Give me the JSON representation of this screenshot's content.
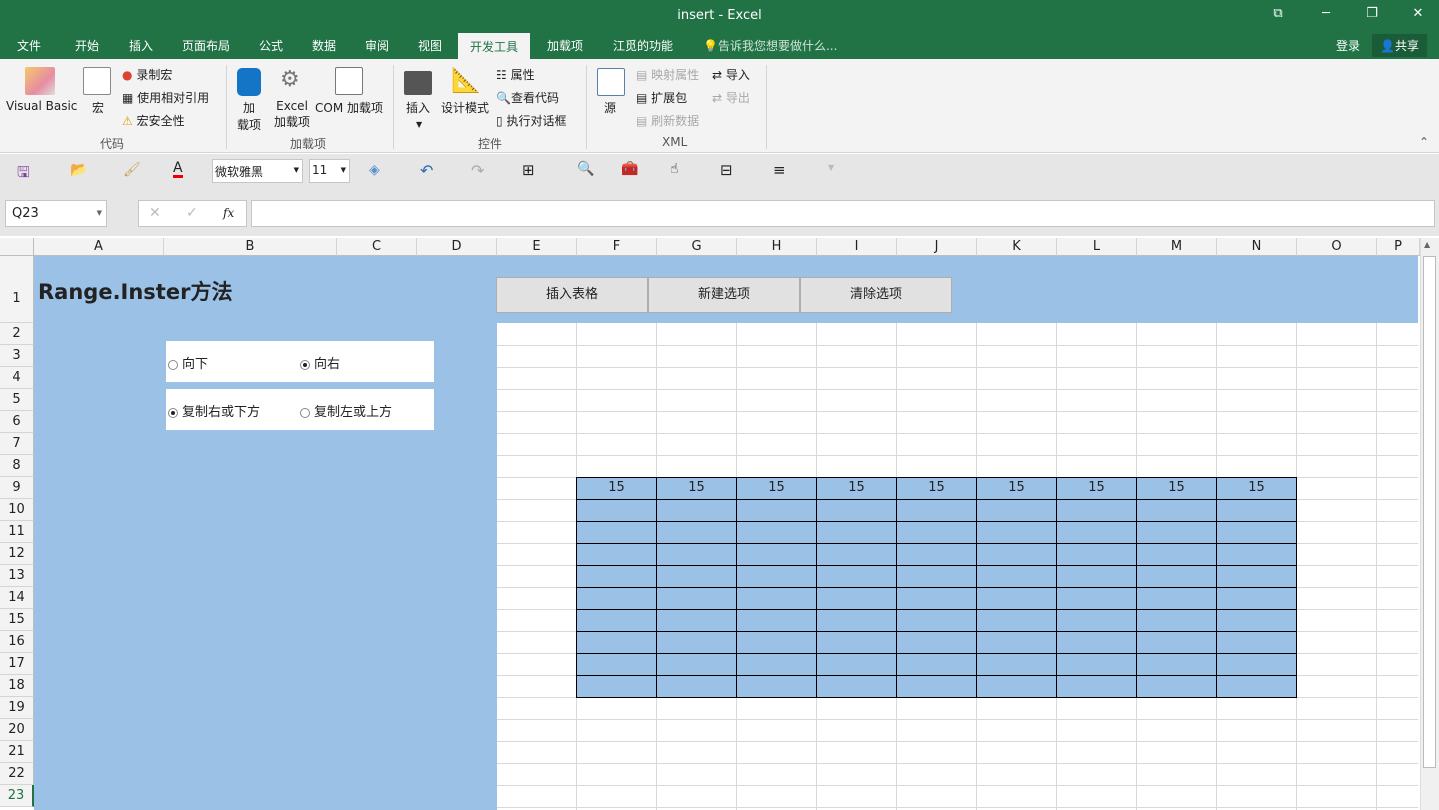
{
  "window": {
    "title": "insert - Excel",
    "controls": [
      "⧉",
      "─",
      "❐",
      "✕"
    ]
  },
  "tabs": [
    "文件",
    "开始",
    "插入",
    "页面布局",
    "公式",
    "数据",
    "审阅",
    "视图",
    "开发工具",
    "加载项",
    "江觅的功能"
  ],
  "active_tab": "开发工具",
  "tell_me": "告诉我您想要做什么...",
  "login": "登录",
  "share": "共享",
  "ribbon": {
    "code": {
      "label": "代码",
      "visual_basic": "Visual Basic",
      "macro": "宏",
      "record": "录制宏",
      "relative": "使用相对引用",
      "security": "宏安全性"
    },
    "addins": {
      "label": "加载项",
      "addin1": "加",
      "addin2": "载项",
      "excel1": "Excel",
      "excel2": "加载项",
      "com": "COM 加载项"
    },
    "controls": {
      "label": "控件",
      "insert": "插入",
      "design": "设计模式",
      "properties": "属性",
      "view_code": "查看代码",
      "run_dialog": "执行对话框"
    },
    "xml": {
      "label": "XML",
      "source": "源",
      "map_props": "映射属性",
      "expansion": "扩展包",
      "refresh": "刷新数据",
      "import": "导入",
      "export": "导出"
    }
  },
  "qat": {
    "font": "微软雅黑",
    "size": "11"
  },
  "formula": {
    "name_box": "Q23",
    "fx": "fx",
    "value": ""
  },
  "columns": [
    "A",
    "B",
    "C",
    "D",
    "E",
    "F",
    "G",
    "H",
    "I",
    "J",
    "K",
    "L",
    "M",
    "N",
    "O",
    "P"
  ],
  "rows": [
    "1",
    "2",
    "3",
    "4",
    "5",
    "6",
    "7",
    "8",
    "9",
    "10",
    "11",
    "12",
    "13",
    "14",
    "15",
    "16",
    "17",
    "18",
    "19",
    "20",
    "21",
    "22",
    "23"
  ],
  "sheet": {
    "title": "Range.Inster方法",
    "buttons": [
      "插入表格",
      "新建选项",
      "清除选项"
    ],
    "group1": [
      {
        "label": "向下",
        "checked": false
      },
      {
        "label": "向右",
        "checked": true
      }
    ],
    "group2": [
      {
        "label": "复制右或下方",
        "checked": true
      },
      {
        "label": "复制左或上方",
        "checked": false
      }
    ],
    "table_header": [
      "15",
      "15",
      "15",
      "15",
      "15",
      "15",
      "15",
      "15",
      "15"
    ],
    "table_body_rows": 9
  },
  "colors": {
    "accent": "#217346",
    "fill": "#9bc2e6"
  }
}
